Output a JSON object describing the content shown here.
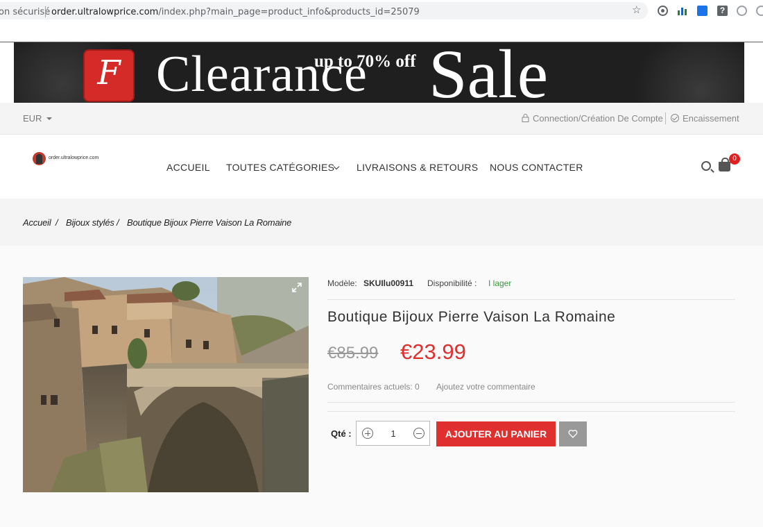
{
  "browser": {
    "security_label": "on sécurisé",
    "url_host": "order.ultralowprice.com",
    "url_path": "/index.php?main_page=product_info&products_id=25079"
  },
  "banner": {
    "logo_letter": "F",
    "headline": "Clearance",
    "promo": "up to 70% off",
    "sale_word": "Sale"
  },
  "utility": {
    "currency": "EUR",
    "login": "Connection/Création De Compte",
    "checkout": "Encaissement"
  },
  "header": {
    "logo_text": "order.ultralowprice.com",
    "nav": [
      "ACCUEIL",
      "TOUTES CATÉGORIES",
      "LIVRAISONS & RETOURS",
      "NOUS CONTACTER"
    ],
    "cart_count": "0"
  },
  "breadcrumb": [
    "Accueil",
    "Bijoux stylés",
    "Boutique Bijoux Pierre Vaison La Romaine"
  ],
  "product": {
    "model_label": "Modèle:",
    "model": "SKUIlu00911",
    "availability_label": "Disponibilité :",
    "availability": "I lager",
    "title": "Boutique Bijoux Pierre Vaison La Romaine",
    "price_old": "€85.99",
    "price_new": "€23.99",
    "reviews": "Commentaires actuels: 0",
    "add_review": "Ajoutez votre commentaire",
    "qty_label": "Qté :",
    "qty": "1",
    "add_to_cart": "AJOUTER AU PANIER"
  },
  "colors": {
    "accent_red": "#e02f2f",
    "in_stock_green": "#3a9a3a"
  }
}
